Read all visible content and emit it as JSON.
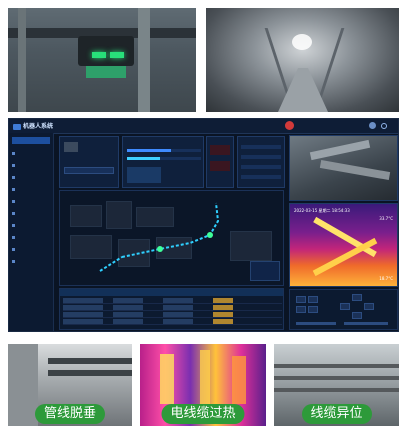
{
  "dashboard": {
    "system_title": "机器人系统",
    "thermal_timestamp": "2022-03-15 星期二 18:54:33",
    "thermal_max_temp": "33.7°C",
    "thermal_min_temp": "18.7°C"
  },
  "scenarios": [
    {
      "label": "管线脱垂"
    },
    {
      "label": "电线缆过热"
    },
    {
      "label": "线缆异位"
    }
  ],
  "colors": {
    "dashboard_bg": "#0a1424",
    "label_green": "#2d9a3a",
    "alarm_red": "#d23a3a"
  }
}
